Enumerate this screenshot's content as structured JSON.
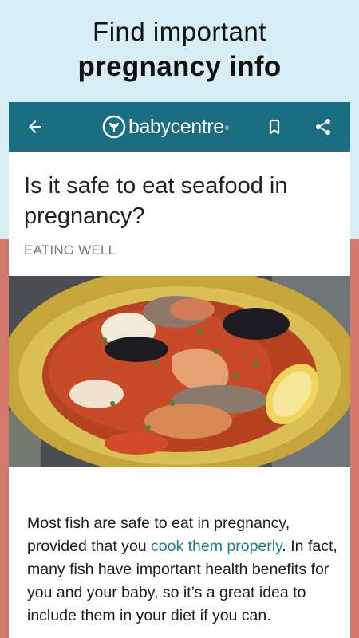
{
  "promo": {
    "line1": "Find important",
    "line2": "pregnancy info"
  },
  "appbar": {
    "brand": "babycentre",
    "brand_mark": "®",
    "icons": [
      "arrow-left-icon",
      "babycentre-logo",
      "bookmark-icon",
      "share-icon"
    ],
    "color": "#1b6e82"
  },
  "article": {
    "title": "Is it safe to eat seafood in pregnancy?",
    "category": "EATING WELL",
    "image_alt": "seafood-stew-image",
    "body_before_link": "Most fish are safe to eat in pregnancy, provided that you ",
    "body_link": "cook them properly",
    "body_after_link": ". In fact, many fish have important health benefits for you and your baby, so it’s a great idea to include them in your diet if you can."
  },
  "colors": {
    "top_background": "#d8eef4",
    "bottom_background": "#d5786c",
    "link": "#1b7f8c"
  }
}
